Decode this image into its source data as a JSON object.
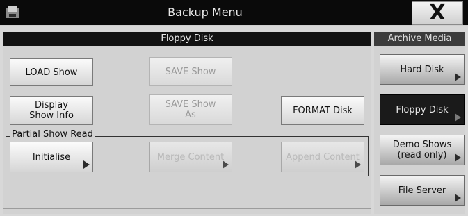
{
  "window": {
    "title": "Backup Menu",
    "close_label": "X"
  },
  "main": {
    "header": "Floppy Disk",
    "buttons": {
      "load_show": "LOAD Show",
      "save_show": "SAVE Show",
      "display_show_info": "Display\nShow Info",
      "save_show_as": "SAVE Show\nAs",
      "format_disk": "FORMAT Disk"
    },
    "partial_read": {
      "label": "Partial Show Read",
      "initialise": "Initialise",
      "merge_content": "Merge Content",
      "append_content": "Append Content"
    }
  },
  "sidebar": {
    "header": "Archive Media",
    "items": [
      {
        "label": "Hard Disk",
        "active": false
      },
      {
        "label": "Floppy Disk",
        "active": true
      },
      {
        "label": "Demo Shows\n(read only)",
        "active": false
      },
      {
        "label": "File Server",
        "active": false
      }
    ]
  },
  "colors": {
    "title_bar": "#0a0a0a",
    "header": "#121212",
    "active_item": "#1a1a1a"
  }
}
